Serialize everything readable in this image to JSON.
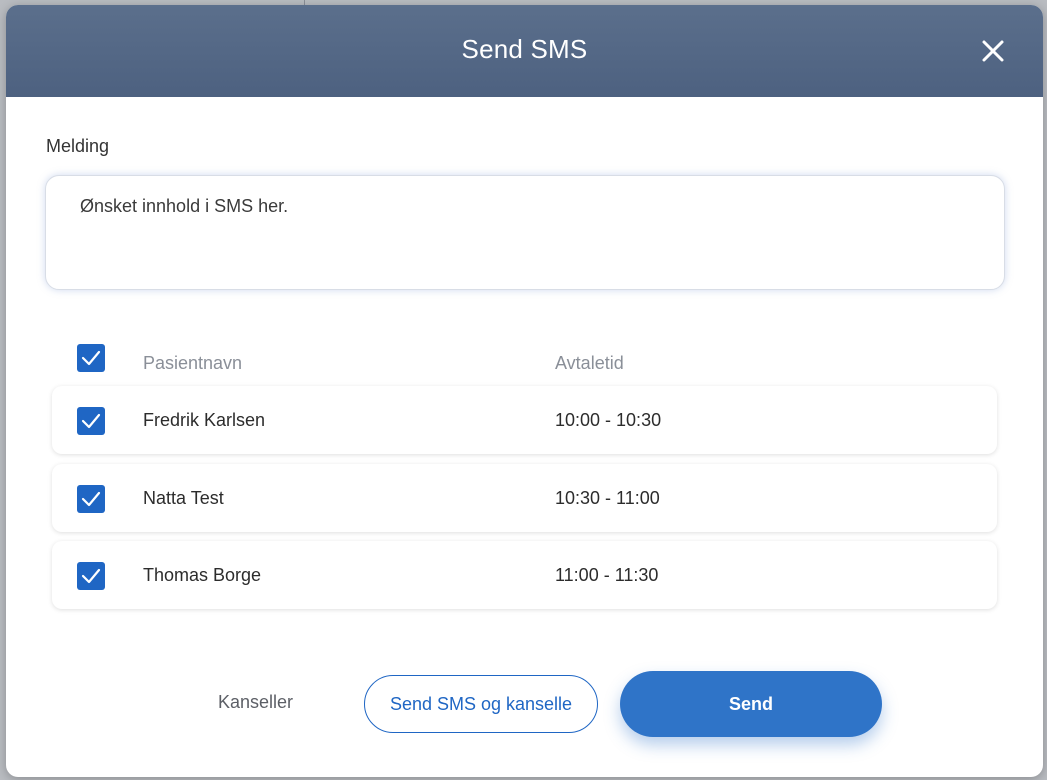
{
  "dialog": {
    "title": "Send SMS"
  },
  "message": {
    "label": "Melding",
    "value": "Ønsket innhold i SMS her."
  },
  "table": {
    "columns": [
      "Pasientnavn",
      "Avtaletid"
    ],
    "select_all_checked": true,
    "rows": [
      {
        "name": "Fredrik Karlsen",
        "time": "10:00 - 10:30",
        "checked": true
      },
      {
        "name": "Natta Test",
        "time": "10:30 - 11:00",
        "checked": true
      },
      {
        "name": "Thomas Borge",
        "time": "11:00 - 11:30",
        "checked": true
      }
    ]
  },
  "footer": {
    "cancel_label": "Kanseller",
    "send_and_cancel_label": "Send SMS og kanselle",
    "send_label": "Send"
  },
  "icons": {
    "close": "close-icon",
    "check": "check-icon"
  },
  "colors": {
    "header_bg": "#4d6180",
    "accent": "#1f66c4",
    "primary_button": "#2f74c8"
  }
}
